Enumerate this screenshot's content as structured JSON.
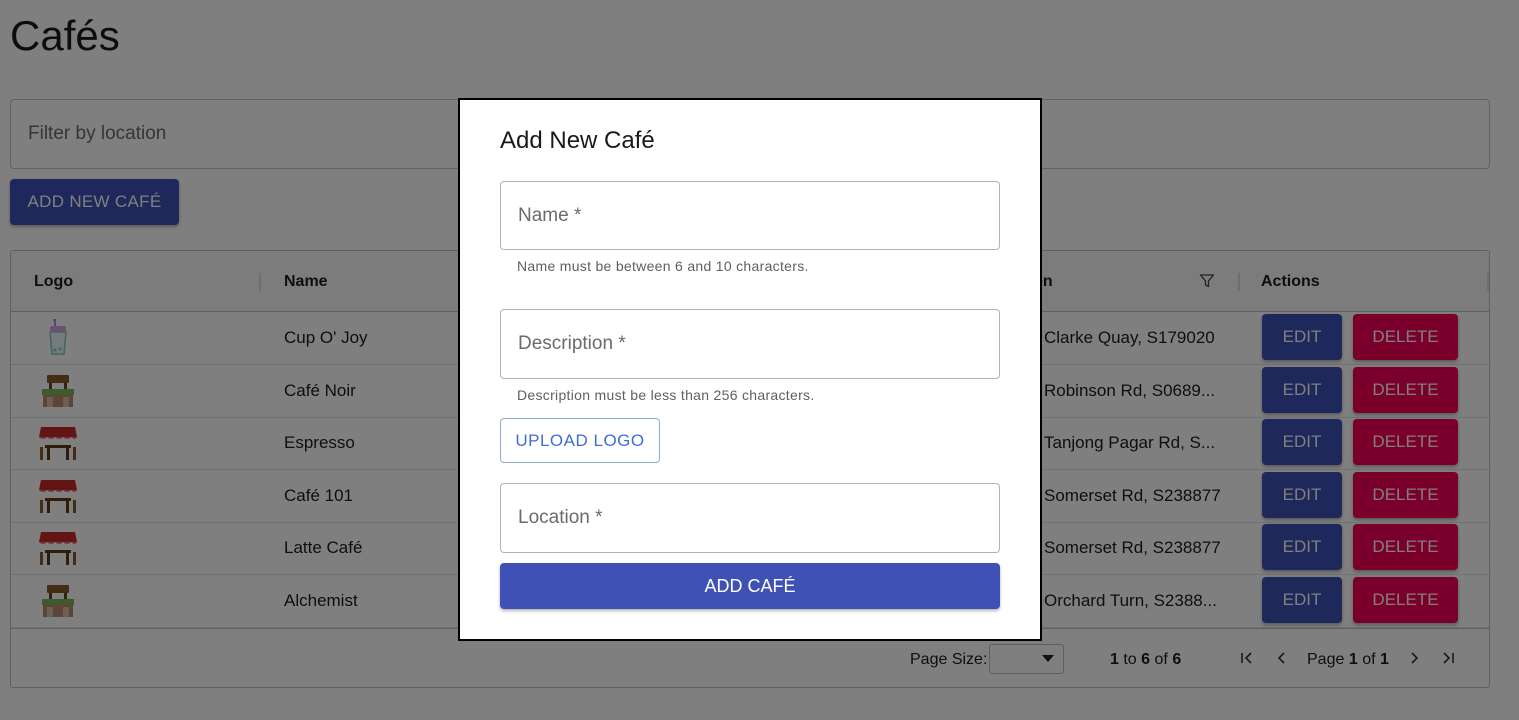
{
  "page": {
    "title": "Cafés"
  },
  "filter": {
    "placeholder": "Filter by location"
  },
  "toolbar": {
    "add_new_label": "ADD NEW CAFÉ"
  },
  "grid": {
    "headers": {
      "logo": "Logo",
      "name": "Name",
      "location": "Location",
      "actions": "Actions"
    },
    "rows": [
      {
        "logo_icon": "bubble-tea-cup-icon",
        "name": "Cup O' Joy",
        "location": "Clarke Quay, S179020"
      },
      {
        "logo_icon": "cafe-stall-icon",
        "name": "Café Noir",
        "location": "Robinson Rd, S0689..."
      },
      {
        "logo_icon": "awning-table-icon",
        "name": "Espresso",
        "location": "Tanjong Pagar Rd, S..."
      },
      {
        "logo_icon": "awning-table-icon",
        "name": "Café 101",
        "location": "Somerset Rd, S238877"
      },
      {
        "logo_icon": "awning-table-icon",
        "name": "Latte Café",
        "location": "Somerset Rd, S238877"
      },
      {
        "logo_icon": "cafe-stall-icon",
        "name": "Alchemist",
        "location": "Orchard Turn, S2388..."
      }
    ],
    "actions": {
      "edit_label": "EDIT",
      "delete_label": "DELETE"
    },
    "footer": {
      "page_size_label": "Page Size:",
      "page_size_value": "",
      "range_from": "1",
      "range_to_label": "to",
      "range_to": "6",
      "range_of_label": "of",
      "range_total": "6",
      "page_label": "Page",
      "page_current": "1",
      "page_of_label": "of",
      "page_total": "1"
    }
  },
  "modal": {
    "title": "Add New Café",
    "name_placeholder": "Name *",
    "name_helper": "Name must be between 6 and 10 characters.",
    "description_placeholder": "Description *",
    "description_helper": "Description must be less than 256 characters.",
    "upload_label": "UPLOAD LOGO",
    "location_placeholder": "Location *",
    "submit_label": "ADD CAFÉ"
  },
  "colors": {
    "primary": "#3f51b5",
    "danger": "#f50057",
    "overlay": "rgba(0,0,0,0.5)"
  }
}
